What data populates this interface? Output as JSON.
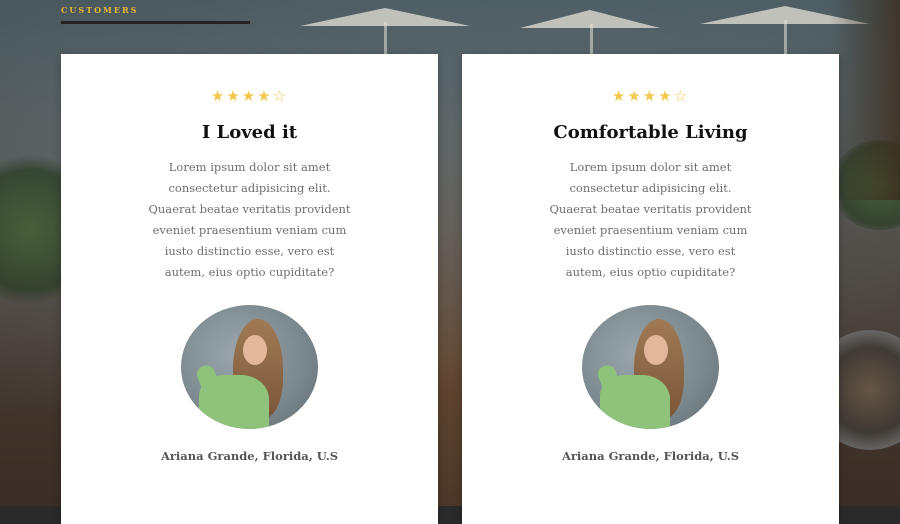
{
  "section": {
    "label": "CUSTOMERS"
  },
  "testimonials": [
    {
      "stars_filled": "★★★★",
      "stars_empty": "☆",
      "rating": 4,
      "title": "I Loved it",
      "text": "Lorem ipsum dolor sit amet consectetur adipisicing elit. Quaerat beatae veritatis provident eveniet praesentium veniam cum iusto distinctio esse, vero est autem, eius optio cupiditate?",
      "name": "Ariana Grande, Florida, U.S"
    },
    {
      "stars_filled": "★★★★",
      "stars_empty": "☆",
      "rating": 4,
      "title": "Comfortable Living",
      "text": "Lorem ipsum dolor sit amet consectetur adipisicing elit. Quaerat beatae veritatis provident eveniet praesentium veniam cum iusto distinctio esse, vero est autem, eius optio cupiditate?",
      "name": "Ariana Grande, Florida, U.S"
    }
  ],
  "colors": {
    "accent": "#e9b630",
    "star": "#f2c94c"
  }
}
